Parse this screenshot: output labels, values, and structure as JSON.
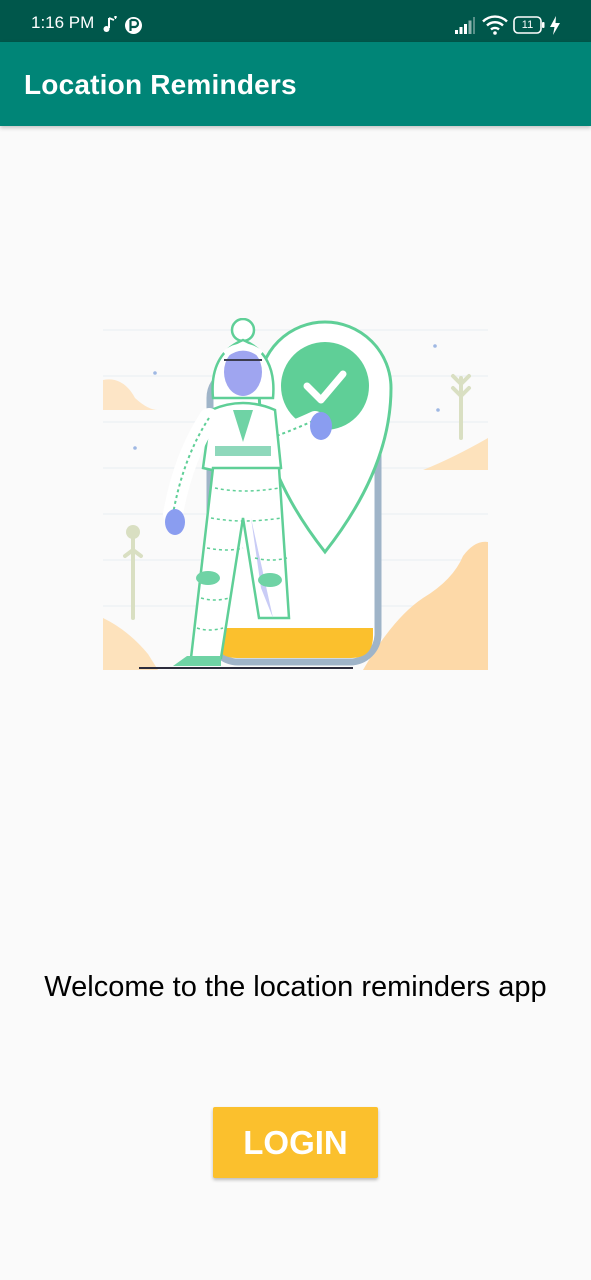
{
  "status_bar": {
    "time": "1:16 PM",
    "battery_level": "11",
    "icons": [
      "music-note-icon",
      "app-notification-icon",
      "signal-icon",
      "wifi-icon",
      "battery-icon",
      "charging-icon"
    ]
  },
  "app_bar": {
    "title": "Location Reminders"
  },
  "hero": {
    "icon": "location-check-illustration"
  },
  "welcome_text": "Welcome to the location reminders app",
  "login_button": {
    "label": "LOGIN"
  },
  "colors": {
    "status_bar": "#00574b",
    "app_bar": "#008577",
    "accent": "#fbc02d",
    "background": "#fafafa"
  }
}
